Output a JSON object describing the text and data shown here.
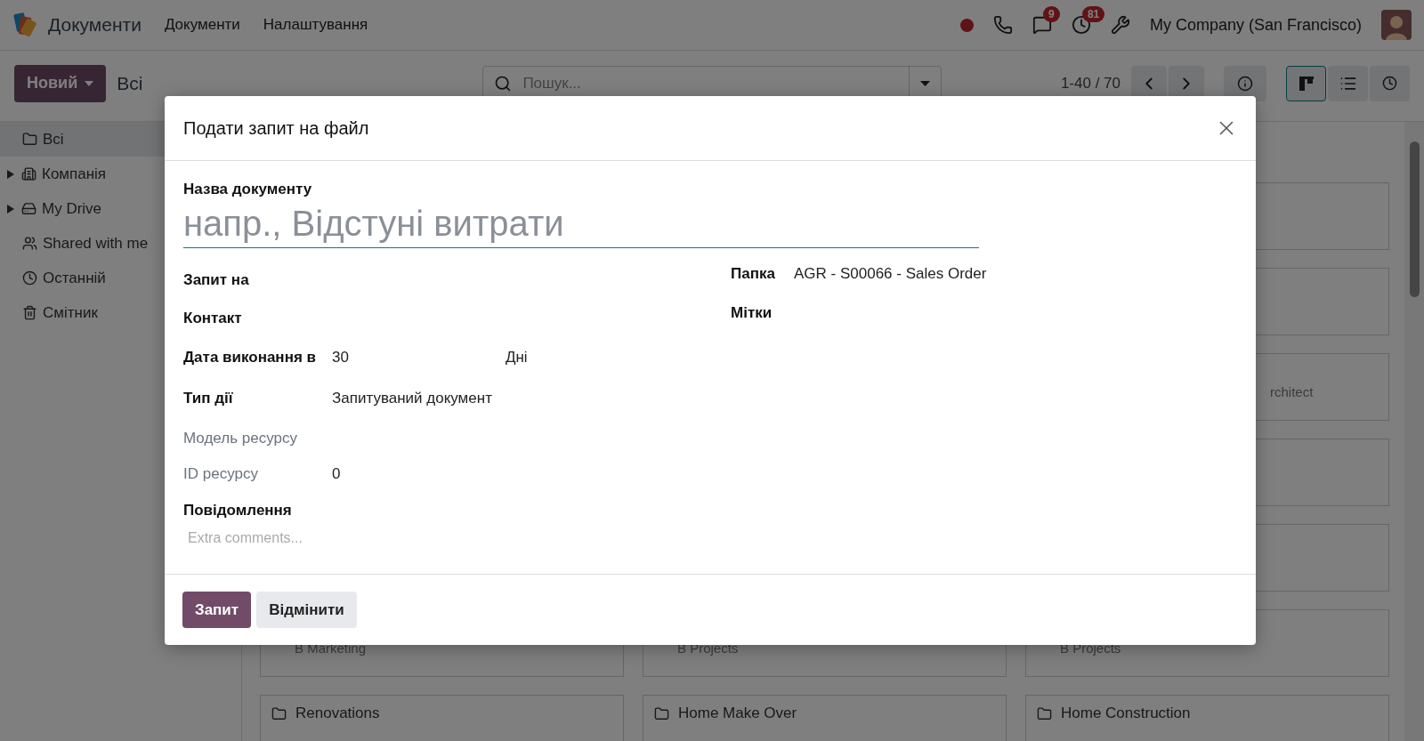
{
  "navbar": {
    "app_name": "Документи",
    "menu": [
      "Документи",
      "Налаштування"
    ],
    "chat_badge": "9",
    "activity_badge": "81",
    "company": "My Company (San Francisco)"
  },
  "control_panel": {
    "new_button": "Новий",
    "breadcrumb": "Всі",
    "search": {
      "placeholder": "Пошук..."
    },
    "pager": "1-40 / 70",
    "views": [
      {
        "kind": "kanban",
        "selected": true
      },
      {
        "kind": "list",
        "selected": false
      },
      {
        "kind": "activity",
        "selected": false
      }
    ]
  },
  "sidebar": {
    "items": [
      {
        "label": "Всі",
        "kind": "folder",
        "selected": true,
        "expandable": false
      },
      {
        "label": "Компанія",
        "kind": "building",
        "selected": false,
        "expandable": true
      },
      {
        "label": "My Drive",
        "kind": "drive",
        "selected": false,
        "expandable": true
      },
      {
        "label": "Shared with me",
        "kind": "users",
        "selected": false,
        "expandable": false
      },
      {
        "label": "Останній",
        "kind": "clock",
        "selected": false,
        "expandable": false
      },
      {
        "label": "Смітник",
        "kind": "trash",
        "selected": false,
        "expandable": false
      }
    ]
  },
  "kanban": {
    "columns": [
      {
        "cards": [
          {
            "kind": "subtitle",
            "subtitle": "B Marketing"
          },
          {
            "kind": "folder",
            "title": "Renovations"
          }
        ]
      },
      {
        "cards": [
          {
            "kind": "subtitle",
            "subtitle": "B Projects"
          },
          {
            "kind": "folder",
            "title": "Home Make Over"
          }
        ]
      },
      {
        "cards": [
          {
            "kind": "blank"
          },
          {
            "kind": "blank"
          },
          {
            "kind": "clipped",
            "subtitle": "rchitect"
          },
          {
            "kind": "blank"
          },
          {
            "kind": "blank"
          },
          {
            "kind": "subtitle",
            "subtitle": "B Projects"
          },
          {
            "kind": "folder",
            "title": "Home Construction"
          }
        ]
      }
    ]
  },
  "dialog": {
    "title": "Подати запит на файл",
    "name_label": "Назва документу",
    "name_placeholder": "напр., Відстуні витрати",
    "left_fields": [
      {
        "label": "Запит на",
        "muted": false
      },
      {
        "label": "Контакт",
        "muted": false
      },
      {
        "label": "Дата виконання в",
        "muted": false,
        "value": "30",
        "unit": "Дні"
      },
      {
        "label": "Тип дії",
        "muted": false,
        "value": "Запитуваний документ"
      },
      {
        "label": "Модель ресурсу",
        "muted": true
      },
      {
        "label": "ID ресурсу",
        "muted": true,
        "value": "0"
      }
    ],
    "right_fields": [
      {
        "label": "Папка",
        "value": "AGR - S00066 - Sales Order"
      },
      {
        "label": "Мітки"
      }
    ],
    "message_label": "Повідомлення",
    "message_placeholder": "Extra comments...",
    "buttons": [
      {
        "label": "Запит",
        "kind": "primary"
      },
      {
        "label": "Відмінити",
        "kind": "secondary"
      }
    ]
  }
}
